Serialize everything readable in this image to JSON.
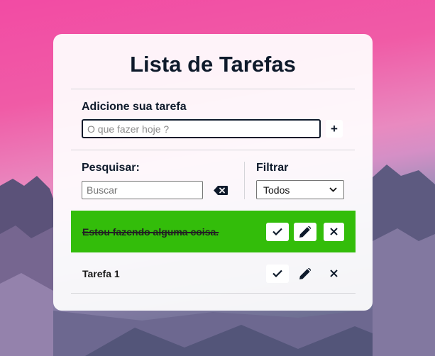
{
  "header": {
    "title": "Lista de Tarefas"
  },
  "add_form": {
    "label": "Adicione sua tarefa",
    "placeholder": "O que fazer hoje ?",
    "add_button": "+"
  },
  "search": {
    "label": "Pesquisar:",
    "placeholder": "Buscar"
  },
  "filter": {
    "label": "Filtrar",
    "selected": "Todos"
  },
  "todos": [
    {
      "text": "Estou fazendo alguma coisa.",
      "done": true
    },
    {
      "text": "Tarefa 1",
      "done": false
    }
  ],
  "icons": {
    "add": "plus-icon",
    "erase": "backspace-icon",
    "done": "check-icon",
    "edit": "pencil-icon",
    "remove": "close-icon",
    "dropdown": "chevron-down-icon"
  },
  "colors": {
    "done_row": "#33bd0a",
    "text_dark": "#0e1a2b"
  }
}
